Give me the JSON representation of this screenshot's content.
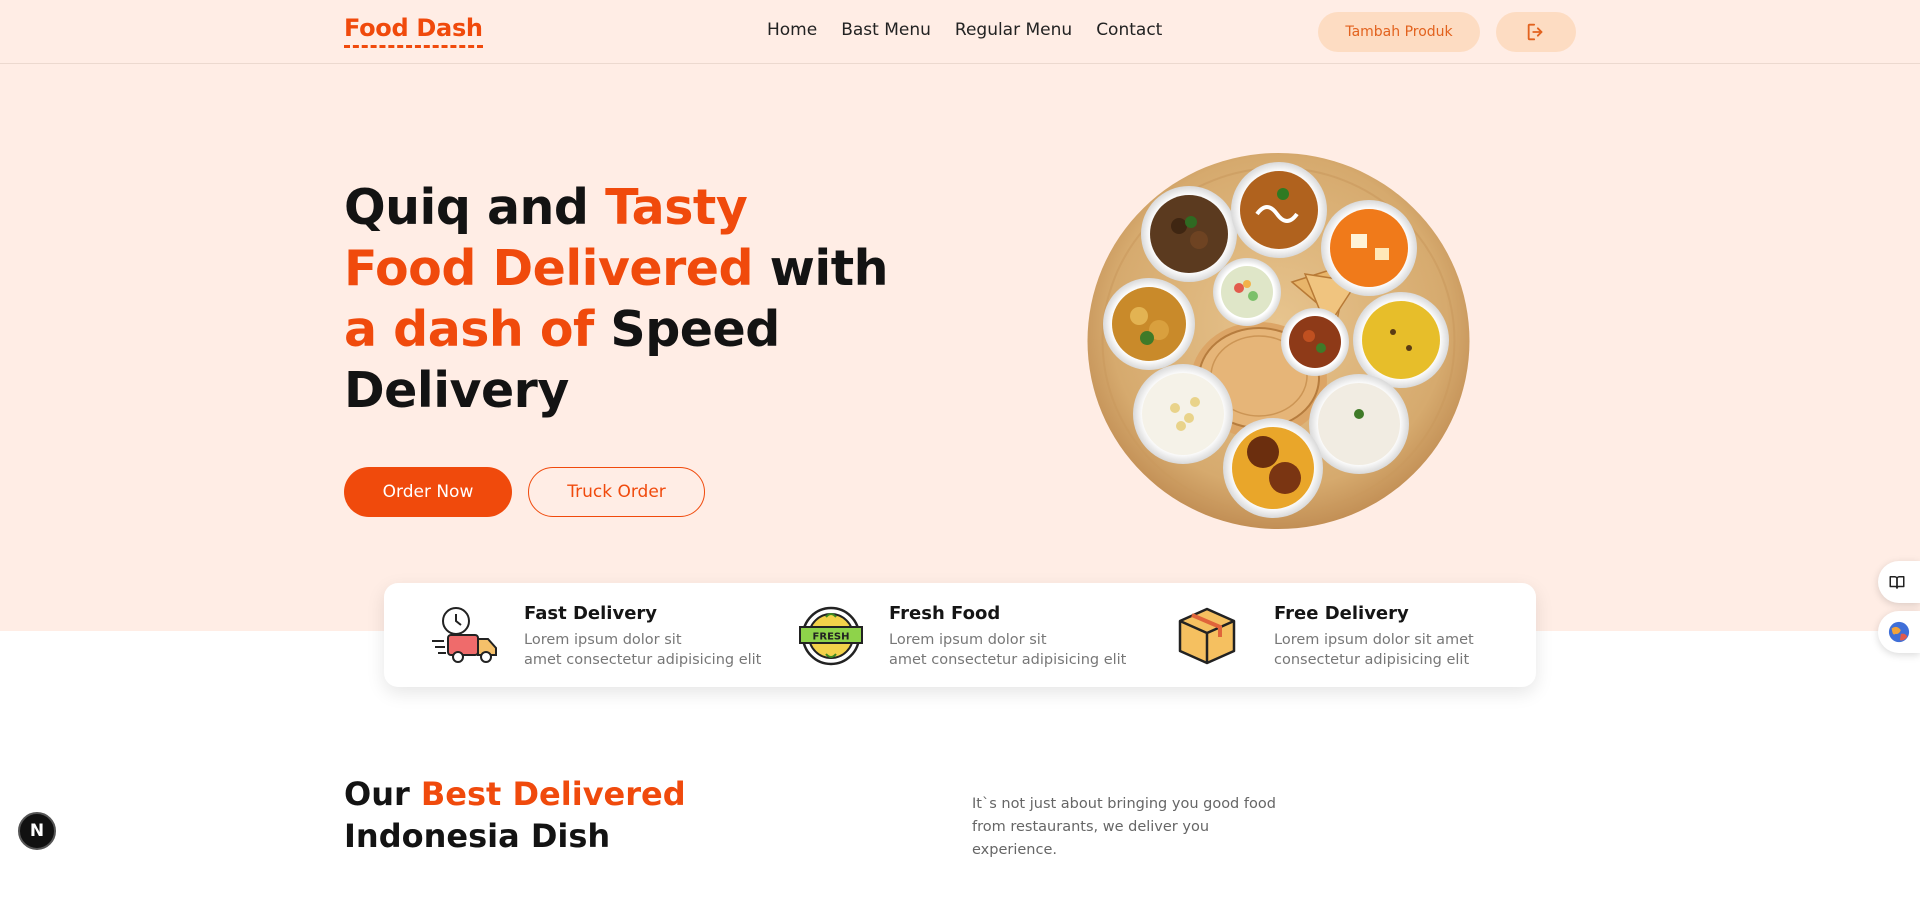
{
  "nav": {
    "logo": "Food Dash",
    "links": [
      "Home",
      "Bast Menu",
      "Regular Menu",
      "Contact"
    ],
    "add_product": "Tambah Produk",
    "logout_icon": "logout-icon"
  },
  "hero": {
    "title_1": "Quiq and ",
    "title_2": "Tasty",
    "title_3": "Food Delivered",
    "title_4": " with",
    "title_5": "a dash of",
    "title_6": " Speed",
    "title_7": "Delivery",
    "order_now": "Order Now",
    "truck_order": "Truck Order",
    "image_icon": "food-platter-image"
  },
  "features": [
    {
      "icon": "delivery-truck-icon",
      "title": "Fast Delivery",
      "desc_1": "Lorem ipsum dolor sit",
      "desc_2": "amet consectetur adipisicing elit"
    },
    {
      "icon": "fresh-badge-icon",
      "title": "Fresh Food",
      "desc_1": "Lorem ipsum dolor sit",
      "desc_2": "amet consectetur adipisicing elit"
    },
    {
      "icon": "package-box-icon",
      "title": "Free Delivery",
      "desc_1": "Lorem ipsum dolor sit amet",
      "desc_2": "consectetur adipisicing elit"
    }
  ],
  "section": {
    "title_1": "Our ",
    "title_2": "Best Delivered",
    "title_3": "Indonesia Dish",
    "desc_1": "It`s not just about bringing you good food",
    "desc_2": "from restaurants, we deliver you experience."
  },
  "badge": {
    "letter": "N"
  },
  "colors": {
    "accent": "#f04a0c",
    "hero_bg": "#ffede5",
    "soft_button": "#fddcc2"
  }
}
